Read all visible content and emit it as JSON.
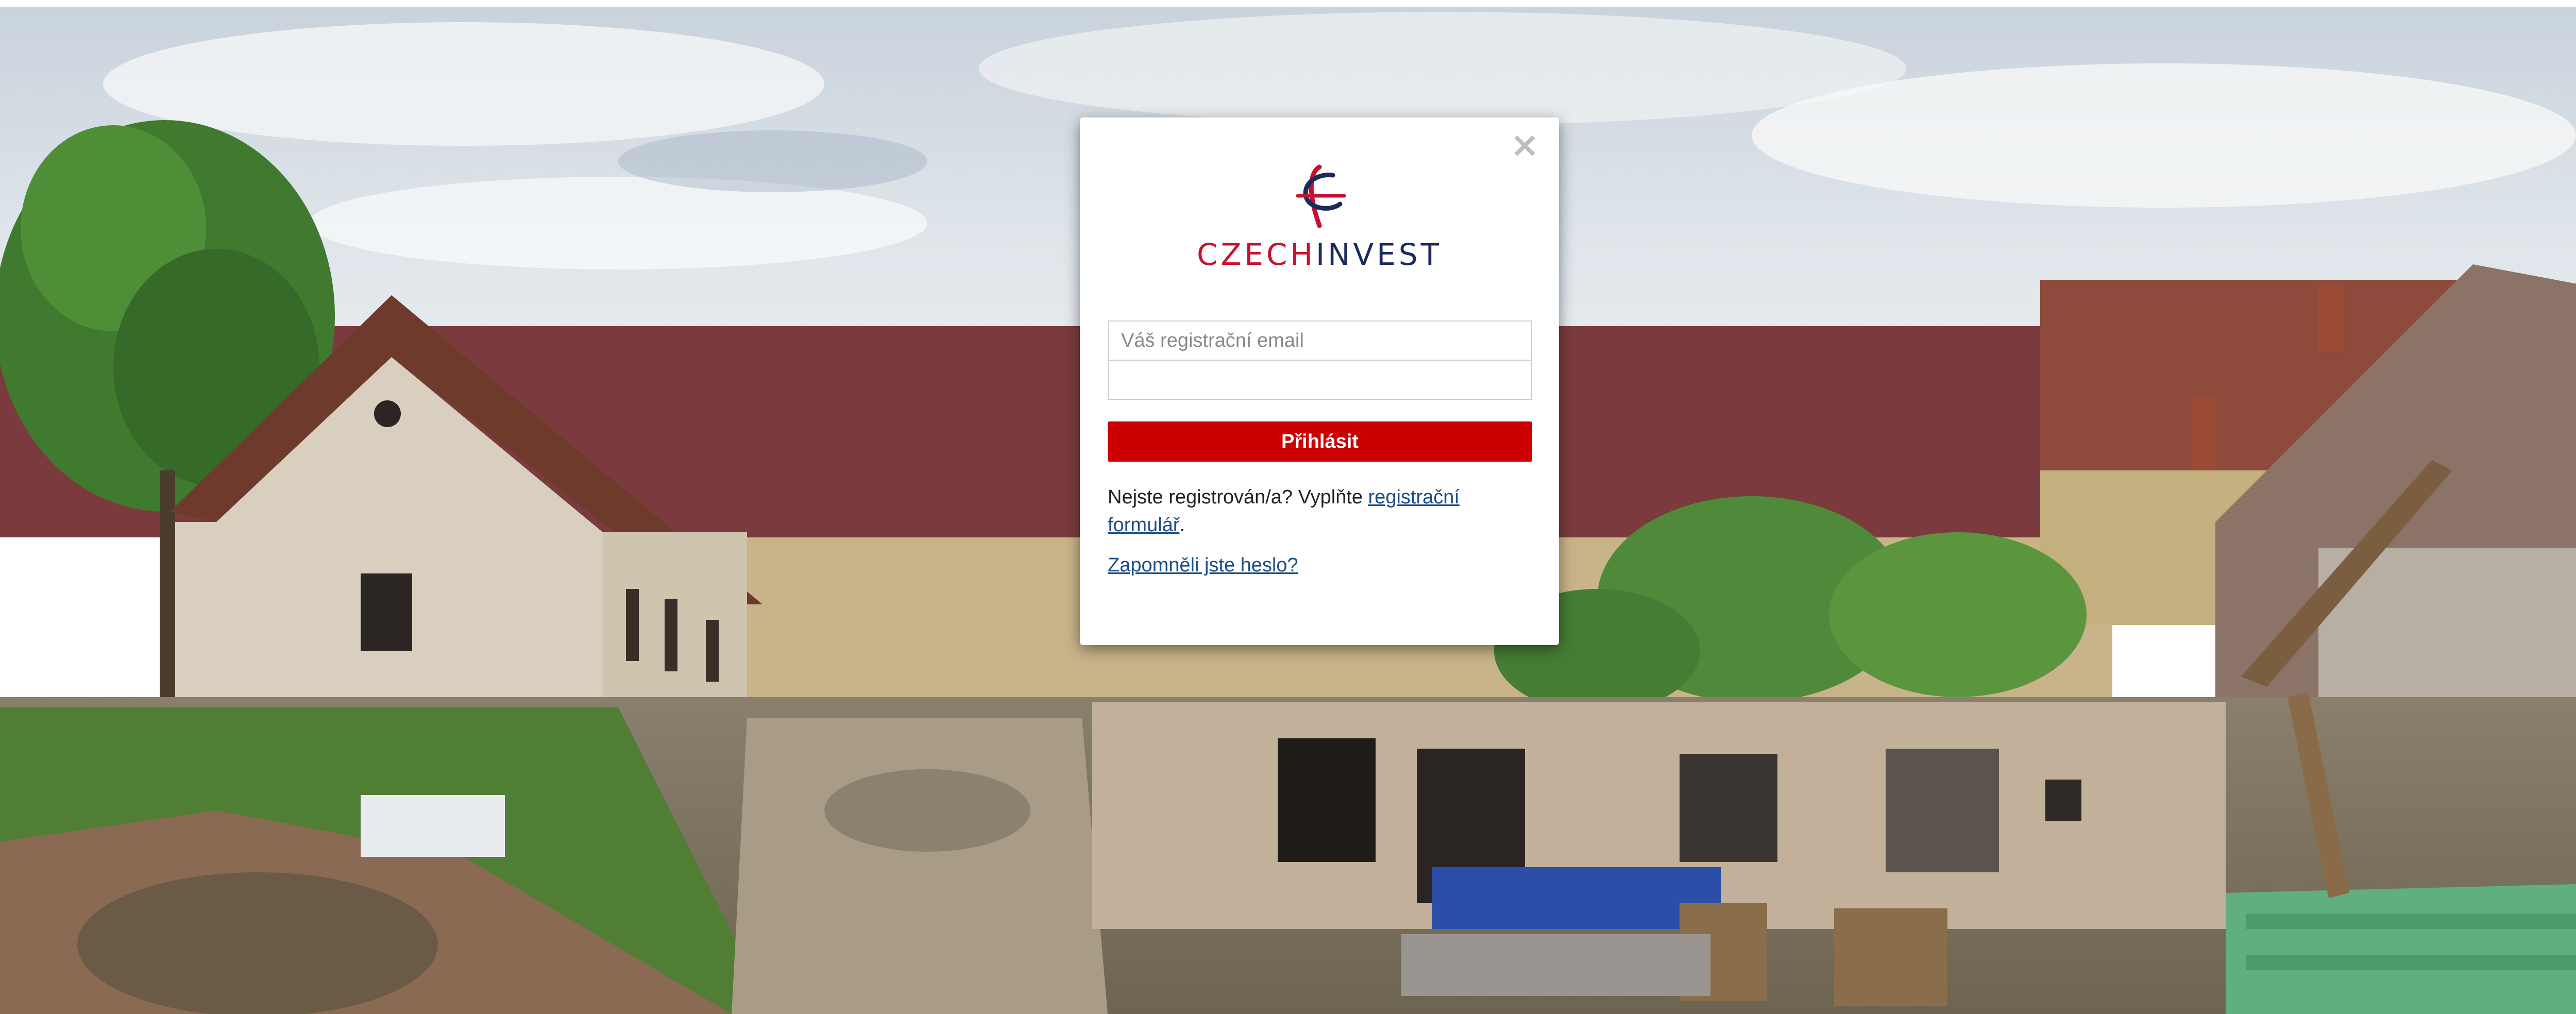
{
  "login_modal": {
    "close_glyph": "×",
    "logo": {
      "part1": "CZECH",
      "part2": "INVEST",
      "color_red": "#c8102e",
      "color_blue": "#1b2a5c"
    },
    "email": {
      "placeholder": "Váš registrační email",
      "value": ""
    },
    "password": {
      "placeholder": "",
      "value": ""
    },
    "submit_label": "Přihlásit",
    "register": {
      "prefix": "Nejste registrován/a? Vyplňte ",
      "link_label": "registrační formulář",
      "suffix": "."
    },
    "forgot_label": "Zapomněli jste heslo?"
  },
  "colors": {
    "accent": "#cc0000",
    "link": "#1a4e8a"
  }
}
